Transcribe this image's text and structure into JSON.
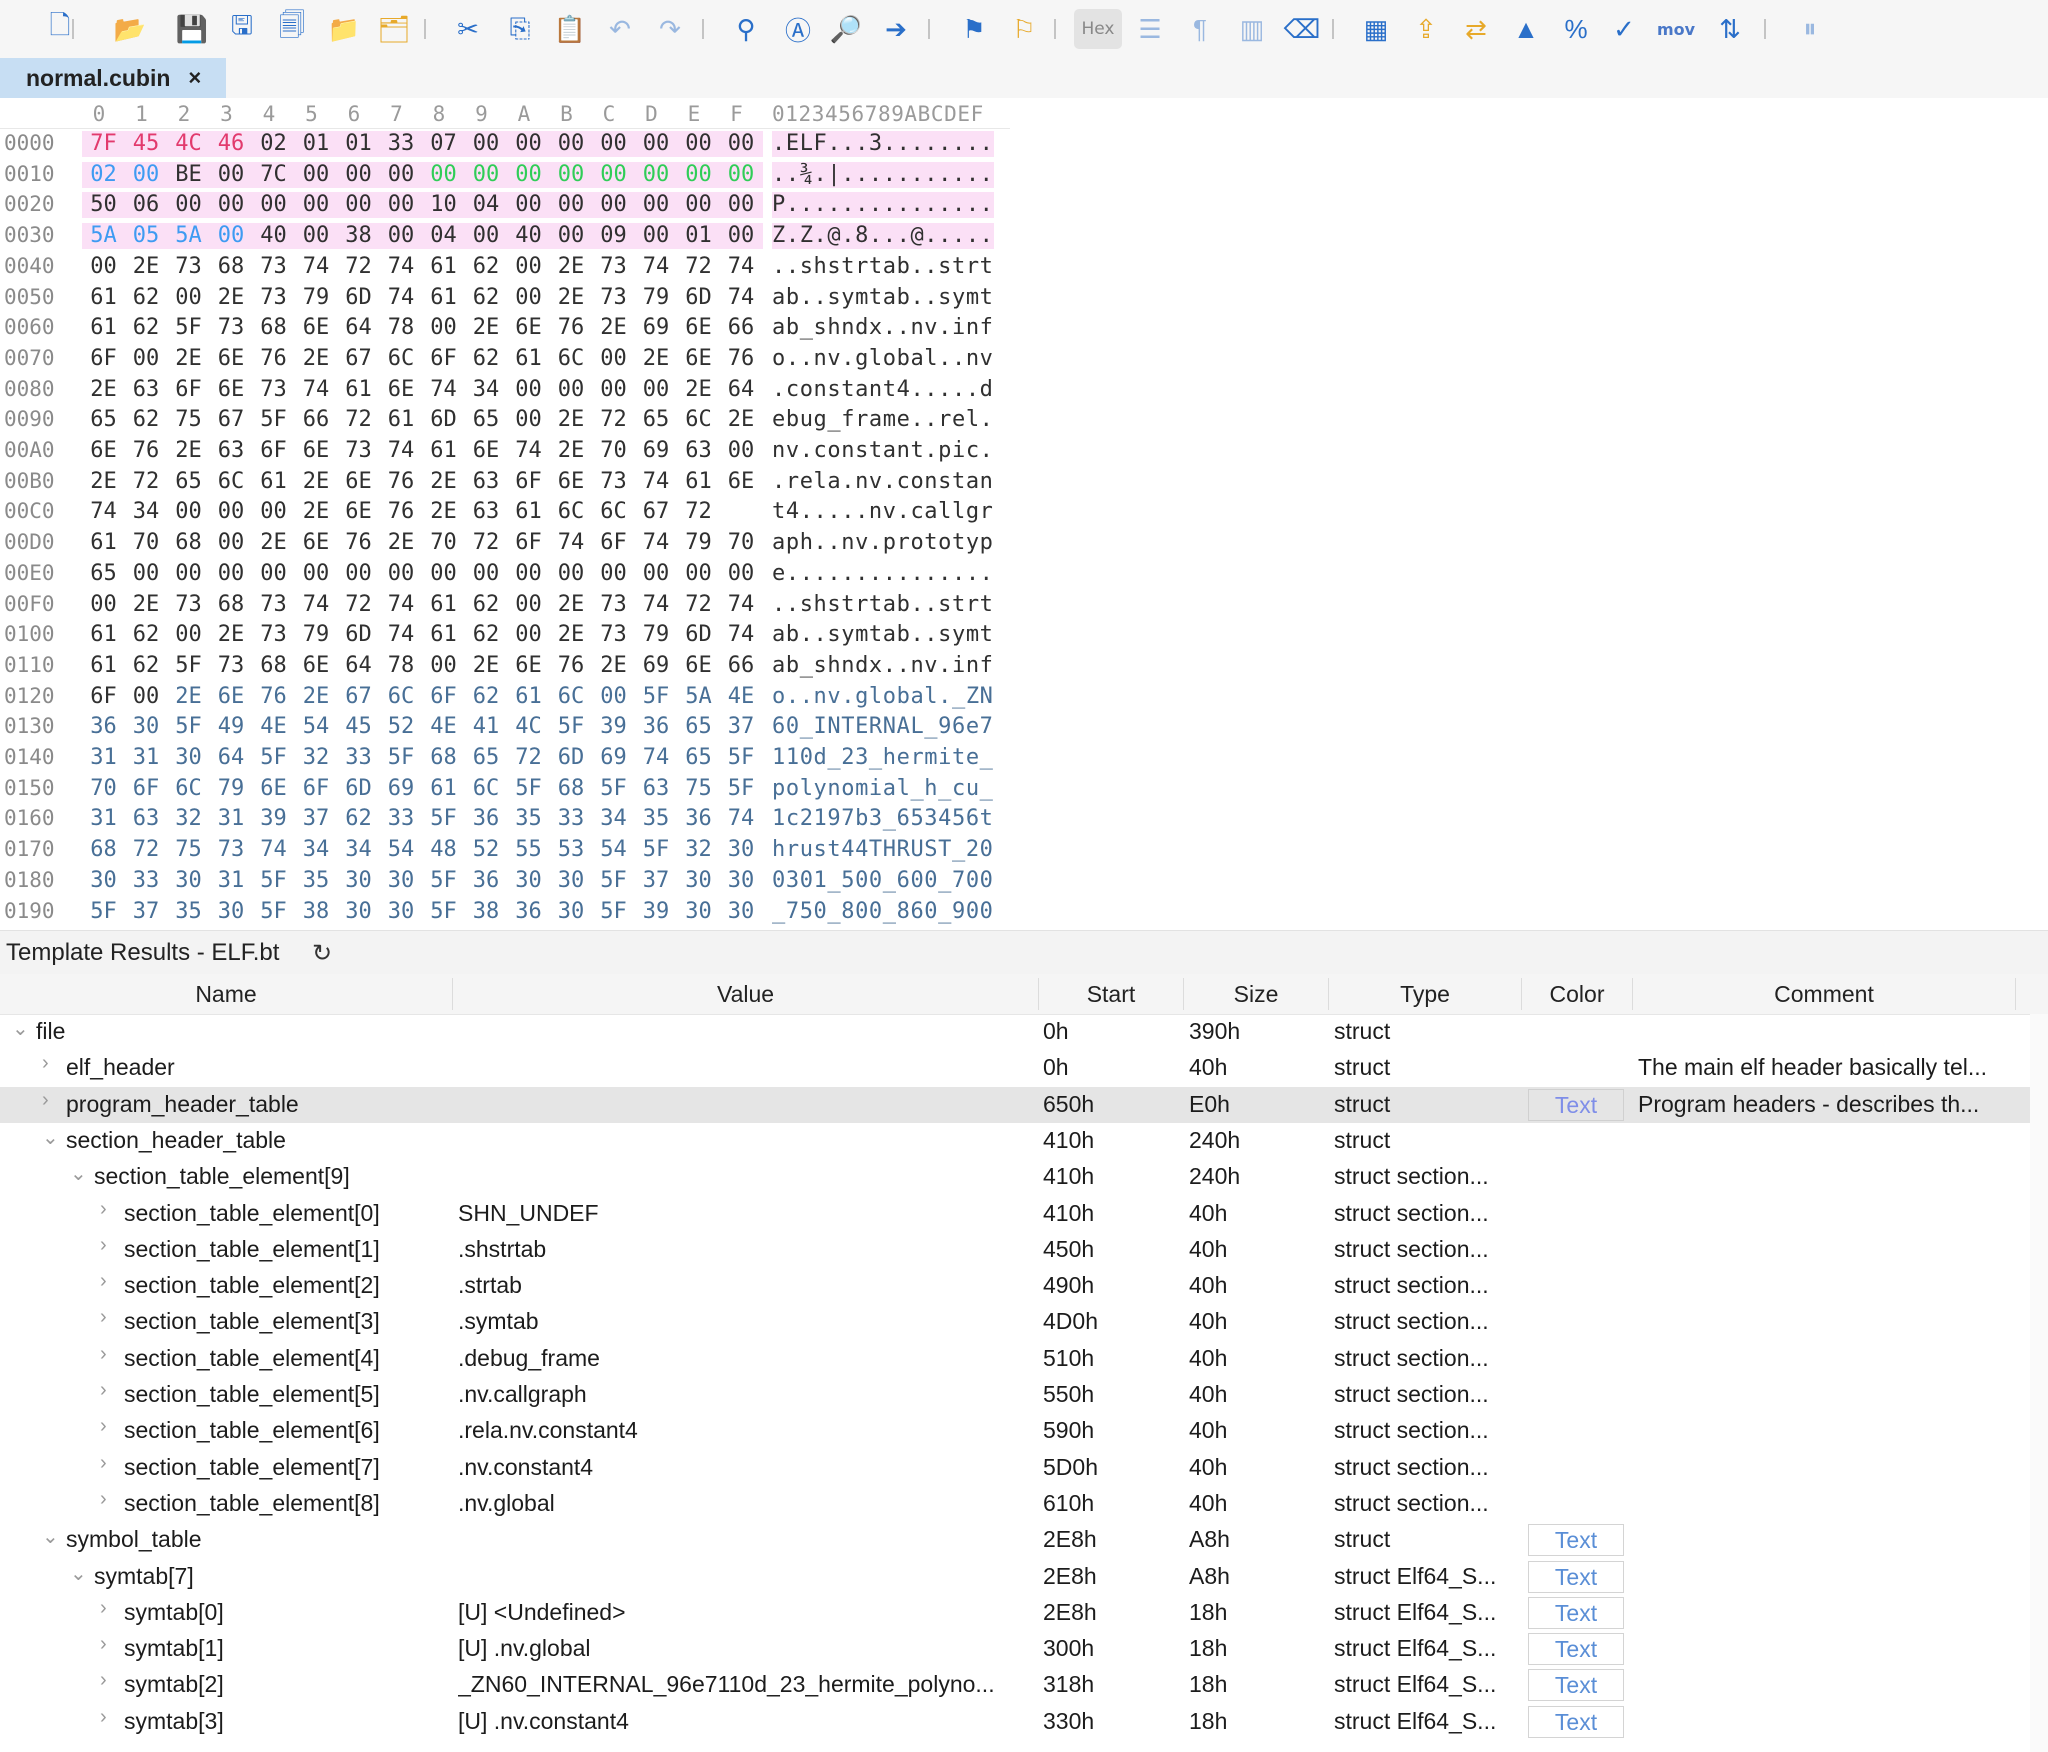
{
  "toolbar": {
    "icons": [
      "new-file-icon",
      "open-folder-icon",
      "save-icon",
      "save-as-icon",
      "save-all-icon",
      "folder-icon",
      "open-project-icon",
      "cut-icon",
      "copy-icon",
      "paste-icon",
      "undo-icon",
      "redo-icon",
      "find-icon",
      "replace-icon",
      "find-in-files-icon",
      "goto-icon",
      "bookmark-icon",
      "bookmark-next-icon",
      "hex-mode-button",
      "columns-icon",
      "paragraph-icon",
      "split-view-icon",
      "eraser-icon",
      "calculator-icon",
      "export-icon",
      "swap-icon",
      "histogram-icon",
      "percent-icon",
      "checksum-icon",
      "mov-button",
      "base-converter-icon",
      "pause-icon"
    ],
    "hex_label": "Hex",
    "mov_label": "mov",
    "base_label": "⇅"
  },
  "tab": {
    "title": "normal.cubin",
    "close": "×"
  },
  "hex": {
    "columns": [
      "0",
      "1",
      "2",
      "3",
      "4",
      "5",
      "6",
      "7",
      "8",
      "9",
      "A",
      "B",
      "C",
      "D",
      "E",
      "F"
    ],
    "ascii_header": "0123456789ABCDEF",
    "rows": [
      {
        "off": "0000",
        "bytes": [
          "7F",
          "45",
          "4C",
          "46",
          "02",
          "01",
          "01",
          "33",
          "07",
          "00",
          "00",
          "00",
          "00",
          "00",
          "00",
          "00"
        ],
        "ascii": ".ELF...3........"
      },
      {
        "off": "0010",
        "bytes": [
          "02",
          "00",
          "BE",
          "00",
          "7C",
          "00",
          "00",
          "00",
          "00",
          "00",
          "00",
          "00",
          "00",
          "00",
          "00",
          "00"
        ],
        "ascii": "..¾.|..........."
      },
      {
        "off": "0020",
        "bytes": [
          "50",
          "06",
          "00",
          "00",
          "00",
          "00",
          "00",
          "00",
          "10",
          "04",
          "00",
          "00",
          "00",
          "00",
          "00",
          "00"
        ],
        "ascii": "P..............."
      },
      {
        "off": "0030",
        "bytes": [
          "5A",
          "05",
          "5A",
          "00",
          "40",
          "00",
          "38",
          "00",
          "04",
          "00",
          "40",
          "00",
          "09",
          "00",
          "01",
          "00"
        ],
        "ascii": "Z.Z.@.8...@....."
      },
      {
        "off": "0040",
        "bytes": [
          "00",
          "2E",
          "73",
          "68",
          "73",
          "74",
          "72",
          "74",
          "61",
          "62",
          "00",
          "2E",
          "73",
          "74",
          "72",
          "74"
        ],
        "ascii": "..shstrtab..strt"
      },
      {
        "off": "0050",
        "bytes": [
          "61",
          "62",
          "00",
          "2E",
          "73",
          "79",
          "6D",
          "74",
          "61",
          "62",
          "00",
          "2E",
          "73",
          "79",
          "6D",
          "74"
        ],
        "ascii": "ab..symtab..symt"
      },
      {
        "off": "0060",
        "bytes": [
          "61",
          "62",
          "5F",
          "73",
          "68",
          "6E",
          "64",
          "78",
          "00",
          "2E",
          "6E",
          "76",
          "2E",
          "69",
          "6E",
          "66"
        ],
        "ascii": "ab_shndx..nv.inf"
      },
      {
        "off": "0070",
        "bytes": [
          "6F",
          "00",
          "2E",
          "6E",
          "76",
          "2E",
          "67",
          "6C",
          "6F",
          "62",
          "61",
          "6C",
          "00",
          "2E",
          "6E",
          "76"
        ],
        "ascii": "o..nv.global..nv"
      },
      {
        "off": "0080",
        "bytes": [
          "2E",
          "63",
          "6F",
          "6E",
          "73",
          "74",
          "61",
          "6E",
          "74",
          "34",
          "00",
          "00",
          "00",
          "00",
          "2E",
          "64"
        ],
        "ascii": ".constant4.....d"
      },
      {
        "off": "0090",
        "bytes": [
          "65",
          "62",
          "75",
          "67",
          "5F",
          "66",
          "72",
          "61",
          "6D",
          "65",
          "00",
          "2E",
          "72",
          "65",
          "6C",
          "2E"
        ],
        "ascii": "ebug_frame..rel."
      },
      {
        "off": "00A0",
        "bytes": [
          "6E",
          "76",
          "2E",
          "63",
          "6F",
          "6E",
          "73",
          "74",
          "61",
          "6E",
          "74",
          "2E",
          "70",
          "69",
          "63",
          "00"
        ],
        "ascii": "nv.constant.pic."
      },
      {
        "off": "00B0",
        "bytes": [
          "2E",
          "72",
          "65",
          "6C",
          "61",
          "2E",
          "6E",
          "76",
          "2E",
          "63",
          "6F",
          "6E",
          "73",
          "74",
          "61",
          "6E"
        ],
        "ascii": ".rela.nv.constan"
      },
      {
        "off": "00C0",
        "bytes": [
          "74",
          "34",
          "00",
          "00",
          "00",
          "2E",
          "6E",
          "76",
          "2E",
          "63",
          "61",
          "6C",
          "6C",
          "67",
          "72"
        ],
        "ascii": "t4.....nv.callgr"
      },
      {
        "off": "00D0",
        "bytes": [
          "61",
          "70",
          "68",
          "00",
          "2E",
          "6E",
          "76",
          "2E",
          "70",
          "72",
          "6F",
          "74",
          "6F",
          "74",
          "79",
          "70"
        ],
        "ascii": "aph..nv.prototyp"
      },
      {
        "off": "00E0",
        "bytes": [
          "65",
          "00",
          "00",
          "00",
          "00",
          "00",
          "00",
          "00",
          "00",
          "00",
          "00",
          "00",
          "00",
          "00",
          "00",
          "00"
        ],
        "ascii": "e..............."
      },
      {
        "off": "00F0",
        "bytes": [
          "00",
          "2E",
          "73",
          "68",
          "73",
          "74",
          "72",
          "74",
          "61",
          "62",
          "00",
          "2E",
          "73",
          "74",
          "72",
          "74"
        ],
        "ascii": "..shstrtab..strt"
      },
      {
        "off": "0100",
        "bytes": [
          "61",
          "62",
          "00",
          "2E",
          "73",
          "79",
          "6D",
          "74",
          "61",
          "62",
          "00",
          "2E",
          "73",
          "79",
          "6D",
          "74"
        ],
        "ascii": "ab..symtab..symt"
      },
      {
        "off": "0110",
        "bytes": [
          "61",
          "62",
          "5F",
          "73",
          "68",
          "6E",
          "64",
          "78",
          "00",
          "2E",
          "6E",
          "76",
          "2E",
          "69",
          "6E",
          "66"
        ],
        "ascii": "ab_shndx..nv.inf"
      },
      {
        "off": "0120",
        "bytes": [
          "6F",
          "00",
          "2E",
          "6E",
          "76",
          "2E",
          "67",
          "6C",
          "6F",
          "62",
          "61",
          "6C",
          "00",
          "5F",
          "5A",
          "4E"
        ],
        "ascii": "o..nv.global._ZN"
      },
      {
        "off": "0130",
        "bytes": [
          "36",
          "30",
          "5F",
          "49",
          "4E",
          "54",
          "45",
          "52",
          "4E",
          "41",
          "4C",
          "5F",
          "39",
          "36",
          "65",
          "37"
        ],
        "ascii": "60_INTERNAL_96e7"
      },
      {
        "off": "0140",
        "bytes": [
          "31",
          "31",
          "30",
          "64",
          "5F",
          "32",
          "33",
          "5F",
          "68",
          "65",
          "72",
          "6D",
          "69",
          "74",
          "65",
          "5F"
        ],
        "ascii": "110d_23_hermite_"
      },
      {
        "off": "0150",
        "bytes": [
          "70",
          "6F",
          "6C",
          "79",
          "6E",
          "6F",
          "6D",
          "69",
          "61",
          "6C",
          "5F",
          "68",
          "5F",
          "63",
          "75",
          "5F"
        ],
        "ascii": "polynomial_h_cu_"
      },
      {
        "off": "0160",
        "bytes": [
          "31",
          "63",
          "32",
          "31",
          "39",
          "37",
          "62",
          "33",
          "5F",
          "36",
          "35",
          "33",
          "34",
          "35",
          "36",
          "74"
        ],
        "ascii": "1c2197b3_653456t"
      },
      {
        "off": "0170",
        "bytes": [
          "68",
          "72",
          "75",
          "73",
          "74",
          "34",
          "34",
          "54",
          "48",
          "52",
          "55",
          "53",
          "54",
          "5F",
          "32",
          "30"
        ],
        "ascii": "hrust44THRUST_20"
      },
      {
        "off": "0180",
        "bytes": [
          "30",
          "33",
          "30",
          "31",
          "5F",
          "35",
          "30",
          "30",
          "5F",
          "36",
          "30",
          "30",
          "5F",
          "37",
          "30",
          "30"
        ],
        "ascii": "0301_500_600_700"
      },
      {
        "off": "0190",
        "bytes": [
          "5F",
          "37",
          "35",
          "30",
          "5F",
          "38",
          "30",
          "30",
          "5F",
          "38",
          "36",
          "30",
          "5F",
          "39",
          "30",
          "30"
        ],
        "ascii": "_750_800_860_900"
      }
    ]
  },
  "template": {
    "title": "Template Results - ELF.bt",
    "refresh_icon": "↻",
    "headers": {
      "name": "Name",
      "value": "Value",
      "start": "Start",
      "size": "Size",
      "type": "Type",
      "color": "Color",
      "comment": "Comment"
    },
    "rows": [
      {
        "name": "file",
        "value": "",
        "start": "0h",
        "size": "390h",
        "type": "struct",
        "color": "",
        "comment": "",
        "level": 0,
        "chev": "v"
      },
      {
        "name": "elf_header",
        "value": "",
        "start": "0h",
        "size": "40h",
        "type": "struct",
        "color": "",
        "comment": "The main elf header basically tel...",
        "level": 1,
        "chev": ">"
      },
      {
        "name": "program_header_table",
        "value": "",
        "start": "650h",
        "size": "E0h",
        "type": "struct",
        "color": "Text",
        "comment": "Program headers - describes th...",
        "level": 1,
        "chev": ">",
        "selected": true
      },
      {
        "name": "section_header_table",
        "value": "",
        "start": "410h",
        "size": "240h",
        "type": "struct",
        "color": "",
        "comment": "",
        "level": 1,
        "chev": "v"
      },
      {
        "name": "section_table_element[9]",
        "value": "",
        "start": "410h",
        "size": "240h",
        "type": "struct section...",
        "color": "",
        "comment": "",
        "level": 2,
        "chev": "v"
      },
      {
        "name": "section_table_element[0]",
        "value": "SHN_UNDEF",
        "start": "410h",
        "size": "40h",
        "type": "struct section...",
        "color": "",
        "comment": "",
        "level": 3,
        "chev": ">"
      },
      {
        "name": "section_table_element[1]",
        "value": ".shstrtab",
        "start": "450h",
        "size": "40h",
        "type": "struct section...",
        "color": "",
        "comment": "",
        "level": 3,
        "chev": ">"
      },
      {
        "name": "section_table_element[2]",
        "value": ".strtab",
        "start": "490h",
        "size": "40h",
        "type": "struct section...",
        "color": "",
        "comment": "",
        "level": 3,
        "chev": ">"
      },
      {
        "name": "section_table_element[3]",
        "value": ".symtab",
        "start": "4D0h",
        "size": "40h",
        "type": "struct section...",
        "color": "",
        "comment": "",
        "level": 3,
        "chev": ">"
      },
      {
        "name": "section_table_element[4]",
        "value": ".debug_frame",
        "start": "510h",
        "size": "40h",
        "type": "struct section...",
        "color": "",
        "comment": "",
        "level": 3,
        "chev": ">"
      },
      {
        "name": "section_table_element[5]",
        "value": ".nv.callgraph",
        "start": "550h",
        "size": "40h",
        "type": "struct section...",
        "color": "",
        "comment": "",
        "level": 3,
        "chev": ">"
      },
      {
        "name": "section_table_element[6]",
        "value": ".rela.nv.constant4",
        "start": "590h",
        "size": "40h",
        "type": "struct section...",
        "color": "",
        "comment": "",
        "level": 3,
        "chev": ">"
      },
      {
        "name": "section_table_element[7]",
        "value": ".nv.constant4",
        "start": "5D0h",
        "size": "40h",
        "type": "struct section...",
        "color": "",
        "comment": "",
        "level": 3,
        "chev": ">"
      },
      {
        "name": "section_table_element[8]",
        "value": ".nv.global",
        "start": "610h",
        "size": "40h",
        "type": "struct section...",
        "color": "",
        "comment": "",
        "level": 3,
        "chev": ">"
      },
      {
        "name": "symbol_table",
        "value": "",
        "start": "2E8h",
        "size": "A8h",
        "type": "struct",
        "color": "Text",
        "comment": "",
        "level": 1,
        "chev": "v",
        "boxed": true
      },
      {
        "name": "symtab[7]",
        "value": "",
        "start": "2E8h",
        "size": "A8h",
        "type": "struct Elf64_S...",
        "color": "Text",
        "comment": "",
        "level": 2,
        "chev": "v",
        "boxed": true
      },
      {
        "name": "symtab[0]",
        "value": "[U] <Undefined>",
        "start": "2E8h",
        "size": "18h",
        "type": "struct Elf64_S...",
        "color": "Text",
        "comment": "",
        "level": 3,
        "chev": ">",
        "boxed": true
      },
      {
        "name": "symtab[1]",
        "value": "[U] .nv.global",
        "start": "300h",
        "size": "18h",
        "type": "struct Elf64_S...",
        "color": "Text",
        "comment": "",
        "level": 3,
        "chev": ">",
        "boxed": true
      },
      {
        "name": "symtab[2]",
        "value": "_ZN60_INTERNAL_96e7110d_23_hermite_polyno...",
        "start": "318h",
        "size": "18h",
        "type": "struct Elf64_S...",
        "color": "Text",
        "comment": "",
        "level": 3,
        "chev": ">",
        "boxed": true
      },
      {
        "name": "symtab[3]",
        "value": "[U] .nv.constant4",
        "start": "330h",
        "size": "18h",
        "type": "struct Elf64_S...",
        "color": "Text",
        "comment": "",
        "level": 3,
        "chev": ">",
        "boxed": true
      }
    ]
  }
}
